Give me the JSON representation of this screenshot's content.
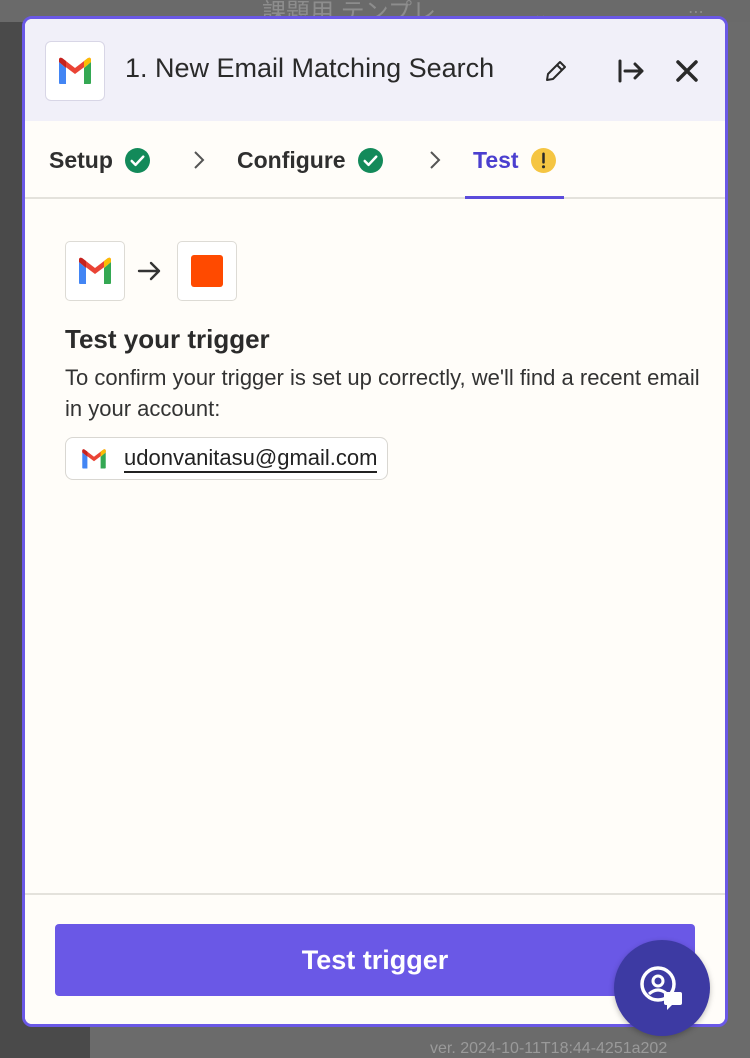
{
  "background": {
    "title": "課題用 テンプレ",
    "version": "ver. 2024-10-11T18:44-4251a202"
  },
  "header": {
    "step_title": "1. New Email Matching Search",
    "app_icon": "gmail-logo",
    "edit_icon": "pencil-icon",
    "collapse_icon": "arrow-to-right-icon",
    "close_icon": "close-icon"
  },
  "tabs": [
    {
      "label": "Setup",
      "status": "complete"
    },
    {
      "label": "Configure",
      "status": "complete"
    },
    {
      "label": "Test",
      "status": "warning",
      "active": true
    }
  ],
  "flow": {
    "from_app": "gmail-logo",
    "to_app": "orange-square-logo"
  },
  "test_section": {
    "title": "Test your trigger",
    "description": "To confirm your trigger is set up correctly, we'll find a recent email in your account:",
    "account_email": "udonvanitasu@gmail.com"
  },
  "footer": {
    "primary_button": "Test trigger"
  },
  "colors": {
    "accent": "#6a58e6",
    "active_tab": "#4b3fcf",
    "success": "#138a5a",
    "warning": "#f5c542",
    "orange": "#ff4a00"
  }
}
